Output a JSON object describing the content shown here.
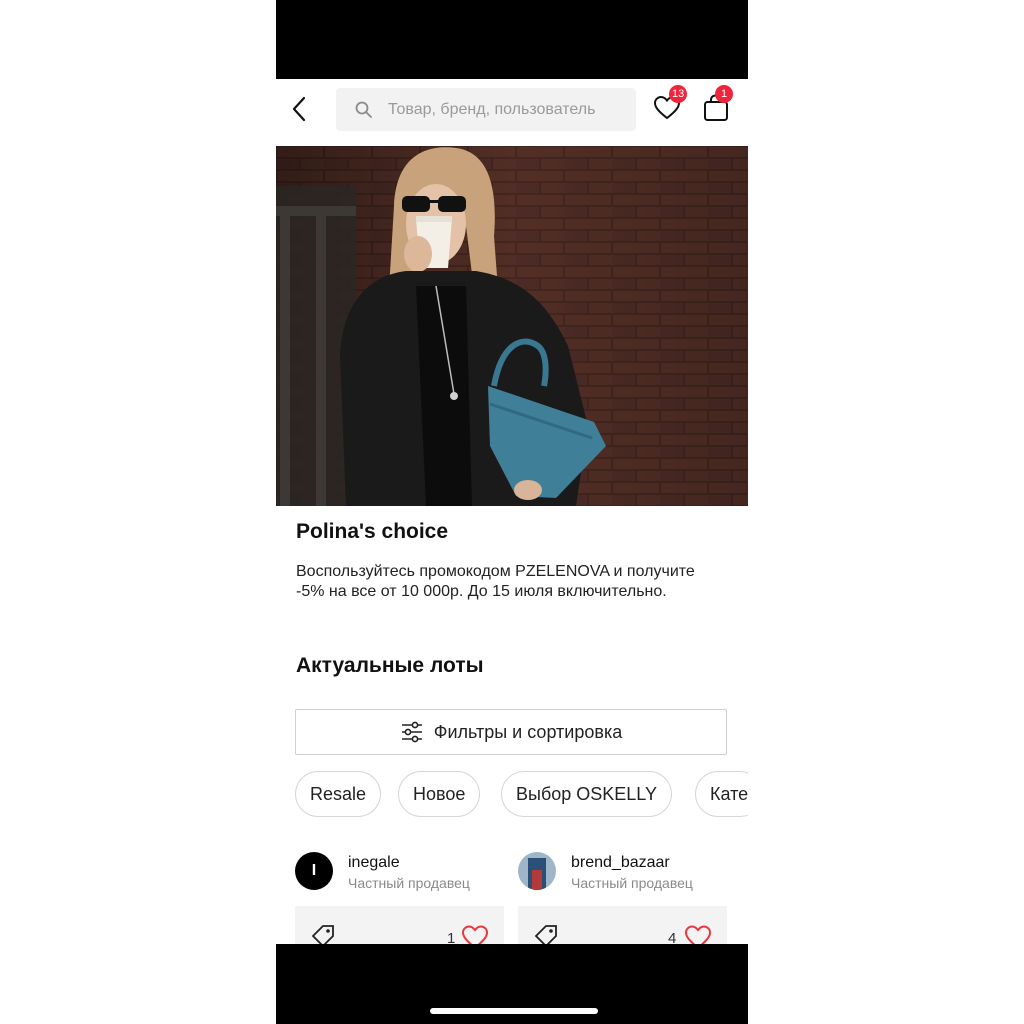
{
  "header": {
    "search_placeholder": "Товар, бренд, пользователь",
    "wishlist_count": "13",
    "cart_count": "1"
  },
  "banner": {
    "title": "Polina's choice",
    "description": "Воспользуйтесь промокодом PZELENOVA и получите -5% на все от 10 000р. До 15 июля включительно."
  },
  "lots": {
    "section_title": "Актуальные лоты",
    "filters_label": "Фильтры и сортировка",
    "chips": [
      "Resale",
      "Новое",
      "Выбор OSKELLY",
      "Кате"
    ]
  },
  "sellers": [
    {
      "name": "inegale",
      "type": "Частный продавец",
      "avatar_letter": "I",
      "likes": "1"
    },
    {
      "name": "brend_bazaar",
      "type": "Частный продавец",
      "likes": "4"
    }
  ],
  "colors": {
    "badge": "#f0243a",
    "heart": "#e8373f",
    "bag": "#3f7f98"
  },
  "icons": [
    "back-arrow-icon",
    "search-icon",
    "heart-icon",
    "bag-icon",
    "filter-icon",
    "tag-icon"
  ]
}
